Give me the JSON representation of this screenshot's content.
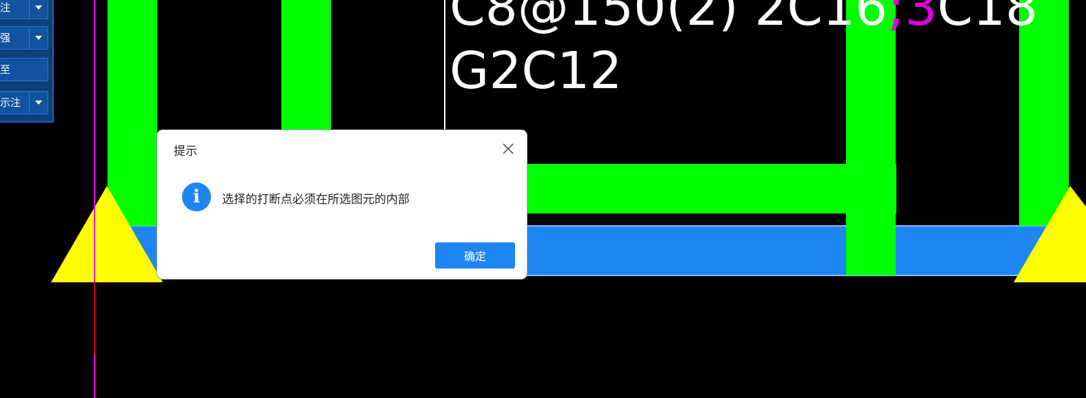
{
  "toolbar": {
    "items": [
      {
        "label": "注",
        "has_dropdown": true
      },
      {
        "label": "强",
        "has_dropdown": true
      },
      {
        "label": "至",
        "has_dropdown": false
      },
      {
        "label": "示注",
        "has_dropdown": true
      }
    ]
  },
  "drawing": {
    "annotation_line1_a": "C8@150(2) 2C16",
    "annotation_line1_sep": ";3",
    "annotation_line1_b": "C18",
    "annotation_line2": "G2C12",
    "colors": {
      "rebar": "#00ff00",
      "beam": "#1e86f0",
      "beam_outline": "#7fc0ff",
      "support": "#ffff00",
      "axis": "#ff00ff",
      "axis_accent": "#cc0000",
      "leader": "#ffffff"
    }
  },
  "dialog": {
    "title": "提示",
    "message": "选择的打断点必须在所选图元的内部",
    "ok_label": "确定",
    "icon": "info-icon",
    "close_icon": "close-icon"
  }
}
